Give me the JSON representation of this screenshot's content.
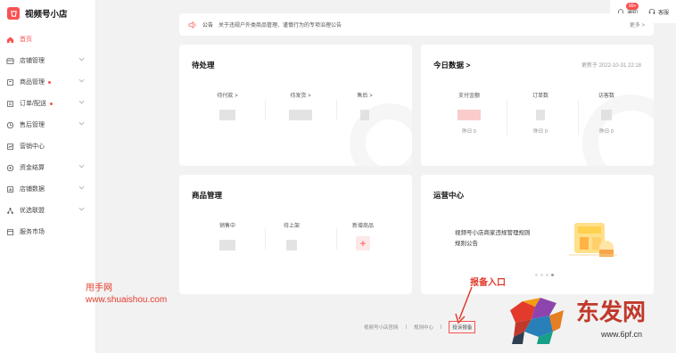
{
  "sidebar": {
    "logo_text": "视频号小店",
    "items": [
      {
        "label": "首页",
        "icon": "home-icon",
        "active": true,
        "chevron": false,
        "dot": false
      },
      {
        "label": "店铺管理",
        "icon": "store-icon",
        "chevron": true,
        "dot": false
      },
      {
        "label": "商品管理",
        "icon": "goods-icon",
        "chevron": true,
        "dot": true
      },
      {
        "label": "订单/配送",
        "icon": "order-icon",
        "chevron": true,
        "dot": true
      },
      {
        "label": "售后管理",
        "icon": "aftersale-icon",
        "chevron": true,
        "dot": false
      },
      {
        "label": "营销中心",
        "icon": "marketing-icon",
        "chevron": false,
        "dot": false
      },
      {
        "label": "资金结算",
        "icon": "funds-icon",
        "chevron": true,
        "dot": false
      },
      {
        "label": "店铺数据",
        "icon": "data-icon",
        "chevron": true,
        "dot": false
      },
      {
        "label": "优选联盟",
        "icon": "alliance-icon",
        "chevron": true,
        "dot": false
      },
      {
        "label": "服务市场",
        "icon": "market-icon",
        "chevron": false,
        "dot": false
      }
    ]
  },
  "topbar": {
    "notify_label": "通知",
    "notify_badge": "99+",
    "help_label": "客服"
  },
  "announcement": {
    "tag": "公告",
    "text": "关于违规户外类商品管理、谨慎行为的专项治理公告",
    "more": "更多 >"
  },
  "pending": {
    "title": "待处理",
    "metrics": [
      {
        "label": "待付款 >"
      },
      {
        "label": "待发货 >"
      },
      {
        "label": "售后 >"
      }
    ]
  },
  "today": {
    "title": "今日数据 >",
    "updated": "更新于 2022-10-31 22:18",
    "metrics": [
      {
        "label": "支付金额",
        "sub": "昨日 0"
      },
      {
        "label": "订单数",
        "sub": "昨日 0"
      },
      {
        "label": "访客数",
        "sub": "昨日 0"
      }
    ]
  },
  "goods": {
    "title": "商品管理",
    "metrics": [
      {
        "label": "销售中"
      },
      {
        "label": "待上架"
      },
      {
        "label": "新增商品",
        "add": "+"
      }
    ]
  },
  "ops": {
    "title": "运营中心",
    "banner_line1": "视频号小店商家违规管理规则",
    "banner_line2": "规则公告"
  },
  "footer": {
    "links": [
      "视频号小店官网",
      "规则中心"
    ],
    "report": "投诉报备"
  },
  "overlay": {
    "site_name": "甩手网",
    "site_url": "www.shuaishou.com",
    "annotation": "报备入口",
    "brand_title": "东发网",
    "brand_url": "www.6pf.cn"
  },
  "colors": {
    "accent": "#fa5151",
    "annotation": "#e23b2c"
  }
}
